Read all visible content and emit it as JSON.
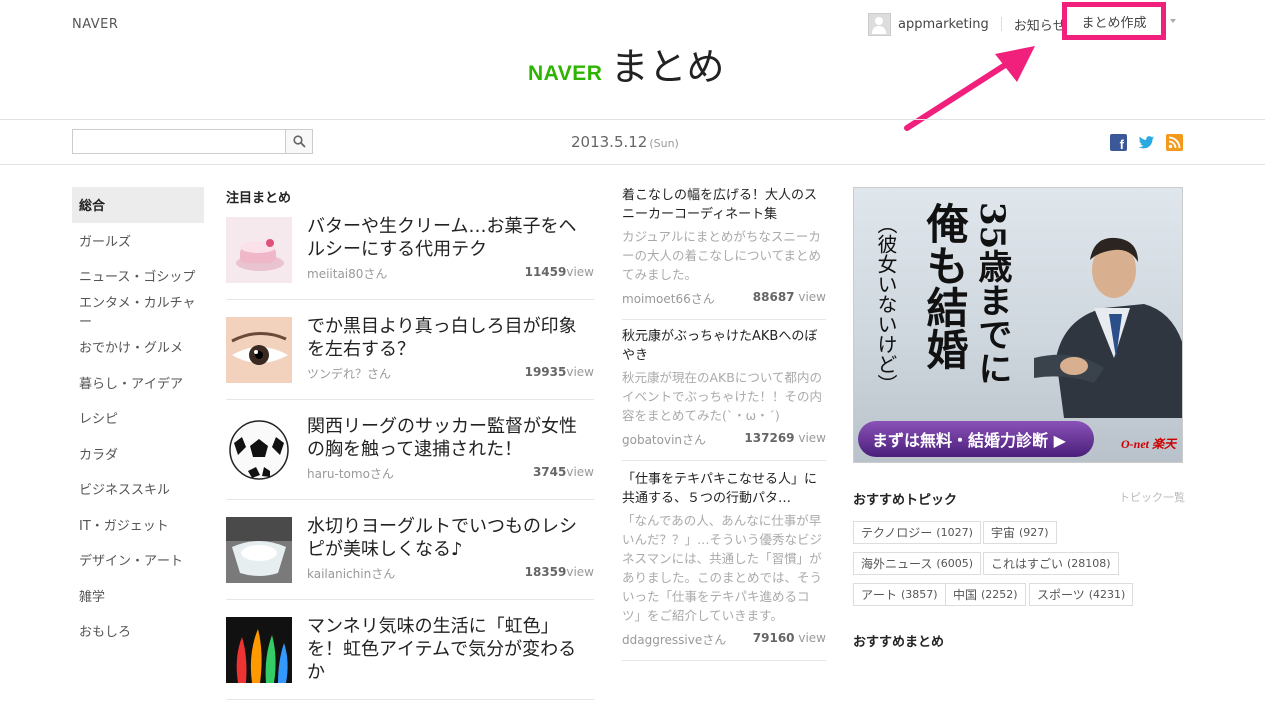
{
  "header": {
    "brand_small": "NAVER",
    "logo_naver": "NAVER",
    "logo_matome": "まとめ",
    "username": "appmarketing",
    "notifications": "お知らせ",
    "create": "まとめ作成"
  },
  "search": {
    "placeholder": "",
    "value": ""
  },
  "date": {
    "main": "2013.5.12",
    "dow": "(Sun)"
  },
  "nav": [
    {
      "label": "総合",
      "active": true
    },
    {
      "label": "ガールズ"
    },
    {
      "label": "ニュース・ゴシップ"
    },
    {
      "label": "エンタメ・カルチャー"
    },
    {
      "label": "おでかけ・グルメ"
    },
    {
      "label": "暮らし・アイデア"
    },
    {
      "label": "レシピ"
    },
    {
      "label": "カラダ"
    },
    {
      "label": "ビジネススキル"
    },
    {
      "label": "IT・ガジェット"
    },
    {
      "label": "デザイン・アート"
    },
    {
      "label": "雑学"
    },
    {
      "label": "おもしろ"
    }
  ],
  "featured": {
    "heading": "注目まとめ",
    "items": [
      {
        "title": "バターや生クリーム…お菓子をヘルシーにする代用テク",
        "user": "meiitai80さん",
        "views": "11459",
        "unit": "view",
        "thumb": "cake-image"
      },
      {
        "title": "でか黒目より真っ白しろ目が印象を左右する？",
        "user": "ツンデれ？さん",
        "views": "19935",
        "unit": "view",
        "thumb": "eye-image"
      },
      {
        "title": "関西リーグのサッカー監督が女性の胸を触って逮捕された！",
        "user": "haru-tomoさん",
        "views": "3745",
        "unit": "view",
        "thumb": "soccer-ball-image"
      },
      {
        "title": "水切りヨーグルトでいつものレシピが美味しくなる♪",
        "user": "kailanichinさん",
        "views": "18359",
        "unit": "view",
        "thumb": "yogurt-image"
      },
      {
        "title": "マンネリ気味の生活に「虹色」を！虹色アイテムで気分が変わるか",
        "user": "",
        "views": "",
        "unit": "",
        "thumb": "rainbow-flame-image"
      }
    ]
  },
  "middle": [
    {
      "title": "着こなしの幅を広げる！大人のスニーカーコーディネート集",
      "desc": "カジュアルにまとめがちなスニーカーの大人の着こなしについてまとめてみました。",
      "user": "moimoet66さん",
      "views": "88687",
      "unit": "view"
    },
    {
      "title": "秋元康がぶっちゃけたAKBへのぼやき",
      "desc": "秋元康が現在のAKBについて都内のイベントでぶっちゃけた！！その内容をまとめてみた(`・ω・´)",
      "user": "gobatovinさん",
      "views": "137269",
      "unit": "view"
    },
    {
      "title": "「仕事をテキパキこなせる人」に共通する、５つの行動パタ…",
      "desc": "「なんであの人、あんなに仕事が早いんだ？？」…そういう優秀なビジネスマンには、共通した「習慣」がありました。このまとめでは、そういった「仕事をテキパキ進めるコツ」をご紹介していきます。",
      "user": "ddaggressiveさん",
      "views": "79160",
      "unit": "view"
    }
  ],
  "ad": {
    "line1": "35歳までに",
    "line2": "俺も結婚",
    "line3": "（彼女いないけど）",
    "cta": "まずは無料・結婚力診断 ▶",
    "brand": "O-net 楽天"
  },
  "topics": {
    "heading": "おすすめトピック",
    "more": "トピック一覧",
    "tags": [
      {
        "name": "テクノロジー",
        "count": "(1027)"
      },
      {
        "name": "宇宙",
        "count": "(927)"
      },
      {
        "name": "海外ニュース",
        "count": "(6005)"
      },
      {
        "name": "これはすごい",
        "count": "(28108)"
      },
      {
        "name": "アート",
        "count": "(3857)"
      },
      {
        "name": "中国",
        "count": "(2252)"
      },
      {
        "name": "スポーツ",
        "count": "(4231)"
      }
    ]
  },
  "recommend_heading": "おすすめまとめ",
  "colors": {
    "naver_green": "#2db400",
    "annotation_pink": "#f0207c"
  }
}
